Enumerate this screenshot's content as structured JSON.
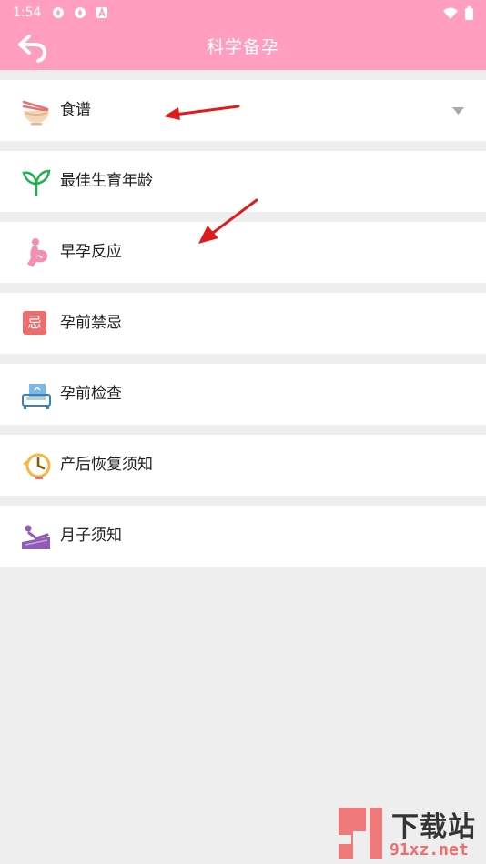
{
  "status_bar": {
    "time": "1:54",
    "icons": [
      "app-notification-icon",
      "app-notification-icon",
      "text-a-icon",
      "wifi-icon",
      "battery-icon"
    ]
  },
  "header": {
    "title": "科学备孕",
    "back_icon": "back-arrow-icon"
  },
  "menu": {
    "items": [
      {
        "label": "食谱",
        "icon": "bowl-chopsticks-icon",
        "expandable": true
      },
      {
        "label": "最佳生育年龄",
        "icon": "sprout-icon"
      },
      {
        "label": "早孕反应",
        "icon": "pregnant-woman-icon"
      },
      {
        "label": "孕前禁忌",
        "icon": "taboo-badge-icon",
        "icon_text": "忌"
      },
      {
        "label": "孕前检查",
        "icon": "examination-machine-icon"
      },
      {
        "label": "产后恢复须知",
        "icon": "clock-recovery-icon"
      },
      {
        "label": "月子须知",
        "icon": "resting-person-icon"
      }
    ]
  },
  "watermark": {
    "logo_text": "下载站",
    "url_text": "91xz.net"
  },
  "colors": {
    "header": "#ff9ebe",
    "background": "#eeeeee",
    "row": "#ffffff",
    "annotation_arrow": "#e01b1b"
  }
}
